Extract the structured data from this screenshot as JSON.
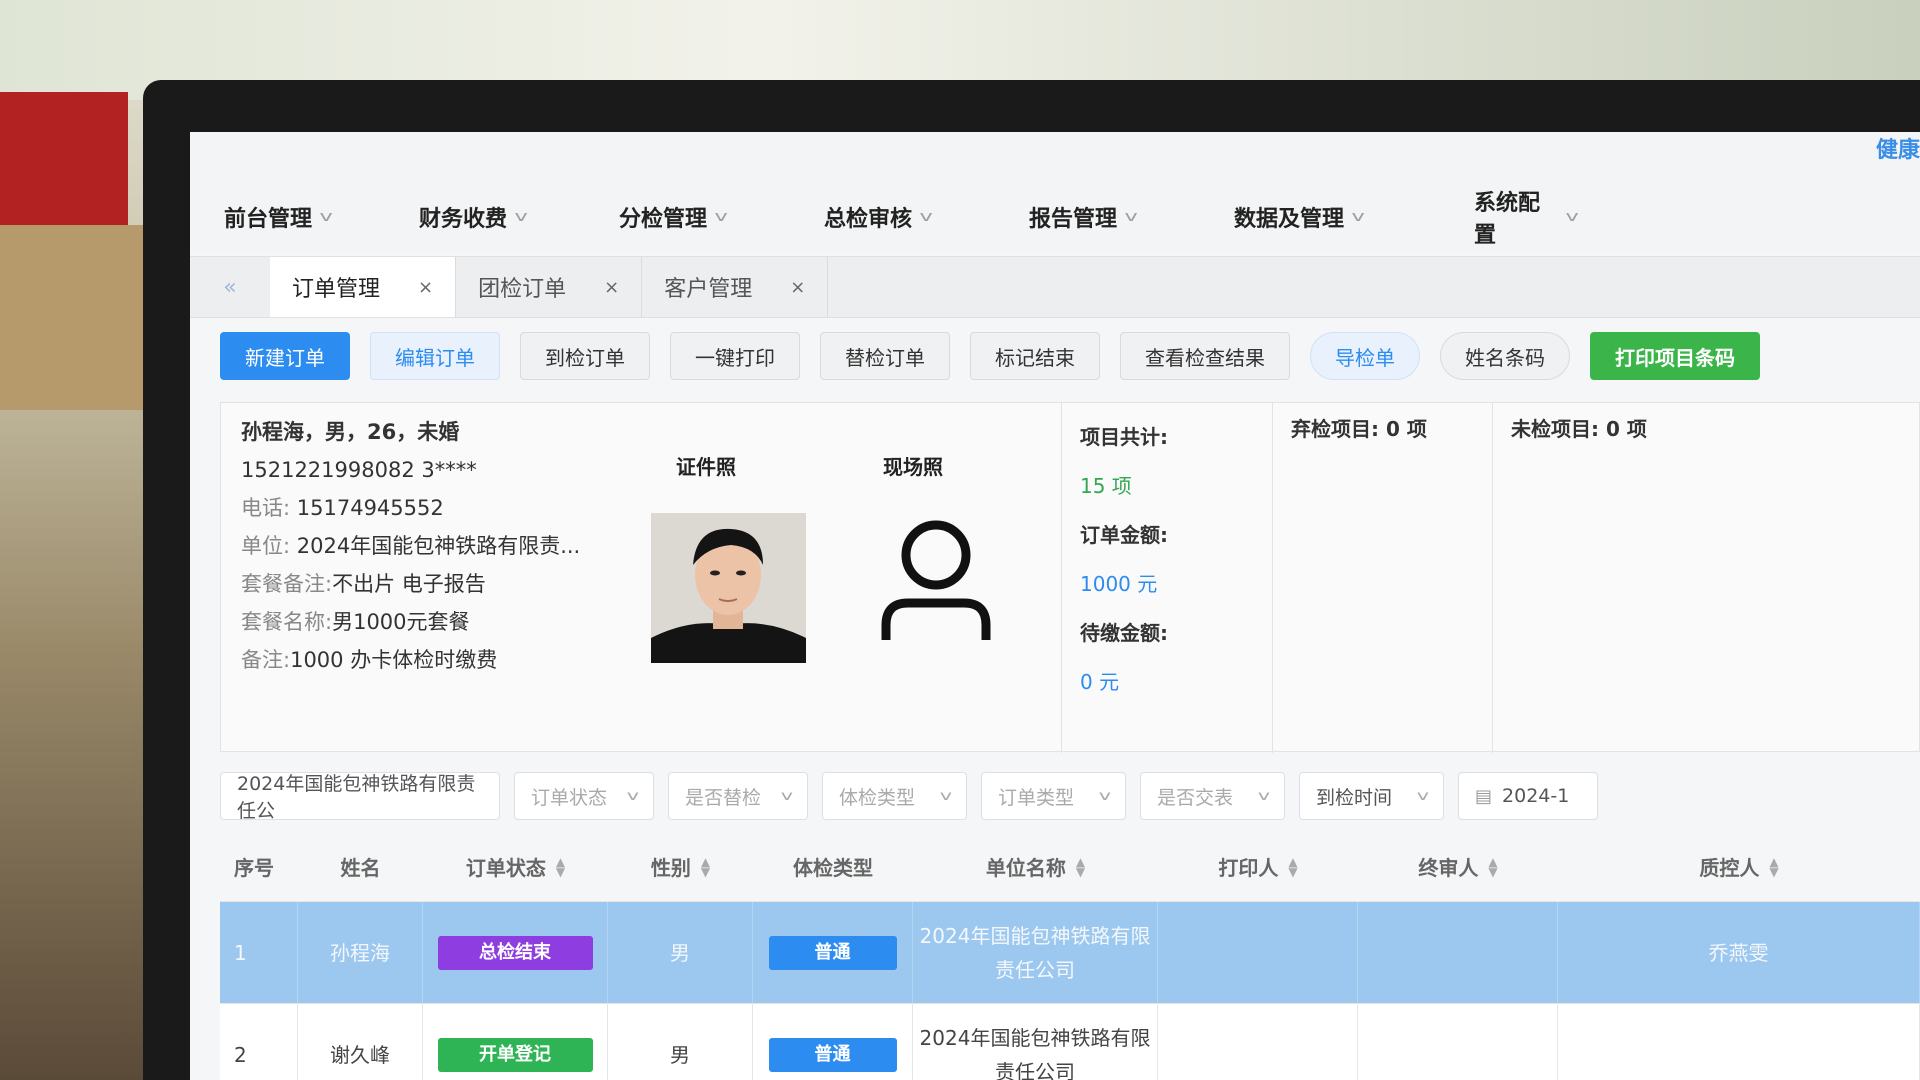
{
  "header": {
    "brand_partial": "健康"
  },
  "menu": [
    {
      "label": "前台管理"
    },
    {
      "label": "财务收费"
    },
    {
      "label": "分检管理"
    },
    {
      "label": "总检审核"
    },
    {
      "label": "报告管理"
    },
    {
      "label": "数据及管理"
    },
    {
      "label": "系统配置"
    }
  ],
  "tabs": [
    {
      "label": "订单管理",
      "active": true
    },
    {
      "label": "团检订单",
      "active": false
    },
    {
      "label": "客户管理",
      "active": false
    }
  ],
  "toolbar": {
    "new_order": "新建订单",
    "edit_order": "编辑订单",
    "arrive_order": "到检订单",
    "print_all": "一键打印",
    "substitute": "替检订单",
    "mark_end": "标记结束",
    "view_results": "查看检查结果",
    "guide_sheet": "导检单",
    "name_barcode": "姓名条码",
    "print_item_barcode": "打印项目条码"
  },
  "person": {
    "summary": "孙程海，男，26，未婚",
    "id_number": "1521221998082 3****",
    "phone_label": "电话:",
    "phone": "15174945552",
    "org_label": "单位:",
    "org": "2024年国能包神铁路有限责...",
    "pkg_note_label": "套餐备注:",
    "pkg_note": "不出片 电子报告",
    "pkg_name_label": "套餐名称:",
    "pkg_name": "男1000元套餐",
    "note_label": "备注:",
    "note": "1000 办卡体检时缴费",
    "id_photo_label": "证件照",
    "site_photo_label": "现场照"
  },
  "summary": {
    "total_label": "项目共计:",
    "total_value": "15 项",
    "amount_label": "订单金额:",
    "amount_value": "1000 元",
    "pending_label": "待缴金额:",
    "pending_value": "0 元",
    "abandoned": "弃检项目: 0 项",
    "unchecked": "未检项目: 0 项"
  },
  "filters": {
    "org": "2024年国能包神铁路有限责任公",
    "order_status": "订单状态",
    "substitute": "是否替检",
    "exam_type": "体检类型",
    "order_type": "订单类型",
    "submitted": "是否交表",
    "arrive_time": "到检时间",
    "date": "2024-1"
  },
  "table": {
    "headers": {
      "index": "序号",
      "name": "姓名",
      "status": "订单状态",
      "gender": "性别",
      "exam_type": "体检类型",
      "org": "单位名称",
      "printer": "打印人",
      "final_reviewer": "终审人",
      "qc": "质控人"
    },
    "rows": [
      {
        "index": "1",
        "name": "孙程海",
        "status": "总检结束",
        "status_color": "#8e3ee0",
        "gender": "男",
        "exam_type": "普通",
        "org": "2024年国能包神铁路有限责任公司",
        "printer": "",
        "final_reviewer": "",
        "qc": "乔燕雯"
      },
      {
        "index": "2",
        "name": "谢久峰",
        "status": "开单登记",
        "status_color": "#2fb455",
        "gender": "男",
        "exam_type": "普通",
        "org": "2024年国能包神铁路有限责任公司",
        "printer": "",
        "final_reviewer": "",
        "qc": ""
      }
    ]
  },
  "colors": {
    "primary": "#2d8cf0",
    "green": "#3bb54a",
    "purple": "#8e3ee0",
    "selected_row": "#9cc7ef"
  }
}
